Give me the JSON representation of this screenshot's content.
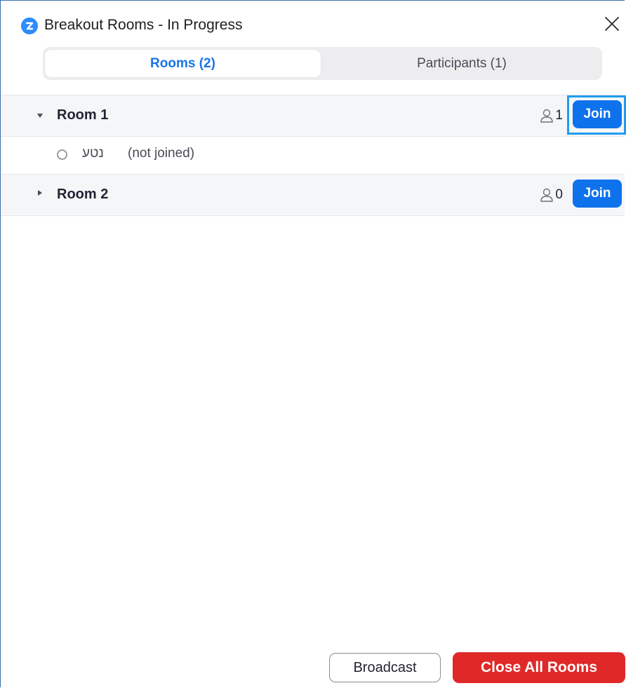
{
  "window": {
    "title": "Breakout Rooms - In Progress",
    "logo_letter": "Z"
  },
  "tabs": [
    {
      "label": "Rooms (2)",
      "active": true
    },
    {
      "label": "Participants (1)",
      "active": false
    }
  ],
  "rooms": [
    {
      "name": "Room 1",
      "expanded": true,
      "count": "1",
      "join_label": "Join",
      "participants": [
        {
          "name": "נטע",
          "status": "(not joined)"
        }
      ]
    },
    {
      "name": "Room 2",
      "expanded": false,
      "count": "0",
      "join_label": "Join",
      "participants": []
    }
  ],
  "footer": {
    "broadcast_label": "Broadcast",
    "close_all_label": "Close All Rooms"
  },
  "colors": {
    "accent": "#0e72ed",
    "danger": "#e02828",
    "focus": "#1f9cf0"
  },
  "icons": {
    "logo": "zoom-logo-icon",
    "close": "close-icon",
    "expand": "caret-down-icon",
    "collapse": "caret-right-icon",
    "person": "person-icon",
    "status": "status-circle-icon"
  }
}
